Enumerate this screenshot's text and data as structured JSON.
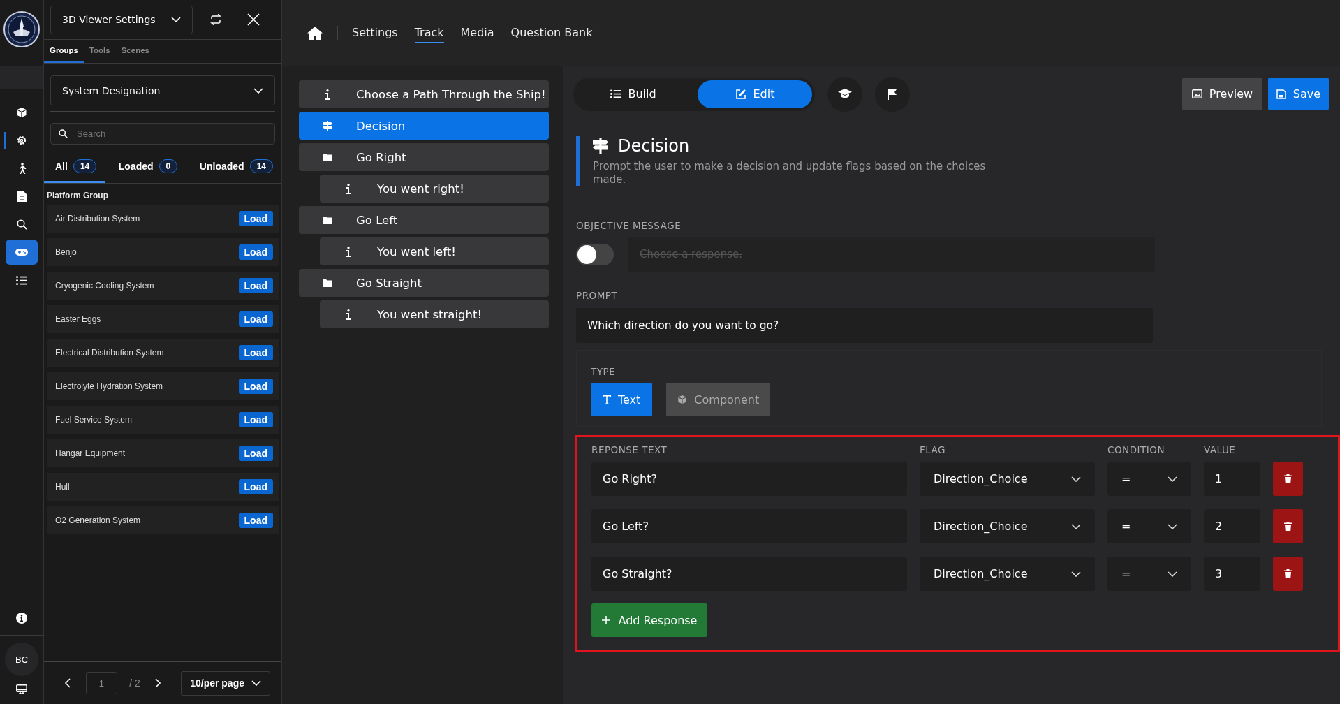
{
  "rail": {
    "items": [
      {
        "kind": "cube",
        "selected": false,
        "indicator": false
      },
      {
        "kind": "gear",
        "selected": false,
        "indicator": true
      },
      {
        "kind": "walker",
        "selected": false,
        "indicator": false
      },
      {
        "kind": "document",
        "selected": false,
        "indicator": false
      },
      {
        "kind": "search",
        "selected": false,
        "indicator": false
      },
      {
        "kind": "gamepad",
        "selected": true,
        "indicator": false
      },
      {
        "kind": "list",
        "selected": false,
        "indicator": false
      }
    ],
    "avatar": "BC"
  },
  "sidebar": {
    "title": "3D Viewer Settings",
    "tabs": [
      {
        "label": "Groups",
        "selected": true
      },
      {
        "label": "Tools",
        "selected": false
      },
      {
        "label": "Scenes",
        "selected": false
      }
    ],
    "dropdown": "System Designation",
    "search": {
      "placeholder": "Search"
    },
    "filters": [
      {
        "label": "All",
        "count": "14",
        "selected": true
      },
      {
        "label": "Loaded",
        "count": "0",
        "selected": false
      },
      {
        "label": "Unloaded",
        "count": "14",
        "selected": false
      }
    ],
    "group_label": "Platform Group",
    "rows": [
      {
        "name": "Air Distribution System",
        "action": "Load"
      },
      {
        "name": "Benjo",
        "action": "Load"
      },
      {
        "name": "Cryogenic Cooling System",
        "action": "Load"
      },
      {
        "name": "Easter Eggs",
        "action": "Load"
      },
      {
        "name": "Electrical Distribution System",
        "action": "Load"
      },
      {
        "name": "Electrolyte Hydration System",
        "action": "Load"
      },
      {
        "name": "Fuel Service System",
        "action": "Load"
      },
      {
        "name": "Hangar Equipment",
        "action": "Load"
      },
      {
        "name": "Hull",
        "action": "Load"
      },
      {
        "name": "O2 Generation System",
        "action": "Load"
      }
    ],
    "pagination": {
      "page": "1",
      "total": "/ 2",
      "per_page": "10/per page"
    }
  },
  "nav": {
    "tabs": [
      {
        "label": "Settings",
        "selected": false
      },
      {
        "label": "Track",
        "selected": true
      },
      {
        "label": "Media",
        "selected": false
      },
      {
        "label": "Question Bank",
        "selected": false
      }
    ]
  },
  "tree": {
    "items": [
      {
        "kind": "info",
        "label": "Choose a Path Through the Ship!",
        "selected": false
      },
      {
        "kind": "decision",
        "label": "Decision",
        "selected": true
      },
      {
        "kind": "folder",
        "label": "Go Right",
        "selected": false,
        "children": [
          {
            "kind": "info",
            "label": "You went right!",
            "selected": false
          }
        ]
      },
      {
        "kind": "folder",
        "label": "Go Left",
        "selected": false,
        "children": [
          {
            "kind": "info",
            "label": "You went left!",
            "selected": false
          }
        ]
      },
      {
        "kind": "folder",
        "label": "Go Straight",
        "selected": false,
        "children": [
          {
            "kind": "info",
            "label": "You went straight!",
            "selected": false
          }
        ]
      }
    ]
  },
  "editor": {
    "modes": [
      {
        "label": "Build",
        "selected": false
      },
      {
        "label": "Edit",
        "selected": true
      }
    ],
    "preview": "Preview",
    "save": "Save",
    "title": "Decision",
    "description": "Prompt the user to make a decision and update flags based on the choices made.",
    "objective": {
      "label": "OBJECTIVE MESSAGE",
      "on": false,
      "placeholder": "Choose a response.",
      "disabled": true
    },
    "prompt": {
      "label": "PROMPT",
      "value": "Which direction do you want to go?"
    },
    "type": {
      "label": "TYPE",
      "options": [
        {
          "kind": "text",
          "label": "Text",
          "selected": true
        },
        {
          "kind": "component",
          "label": "Component",
          "selected": false
        }
      ]
    },
    "responses": {
      "highlighted": true,
      "columns": [
        "REPONSE TEXT",
        "FLAG",
        "CONDITION",
        "VALUE"
      ],
      "rows": [
        {
          "text": "Go Right?",
          "flag": "Direction_Choice",
          "condition": "=",
          "value": "1"
        },
        {
          "text": "Go Left?",
          "flag": "Direction_Choice",
          "condition": "=",
          "value": "2"
        },
        {
          "text": "Go Straight?",
          "flag": "Direction_Choice",
          "condition": "=",
          "value": "3"
        }
      ],
      "add_label": "Add Response"
    }
  }
}
